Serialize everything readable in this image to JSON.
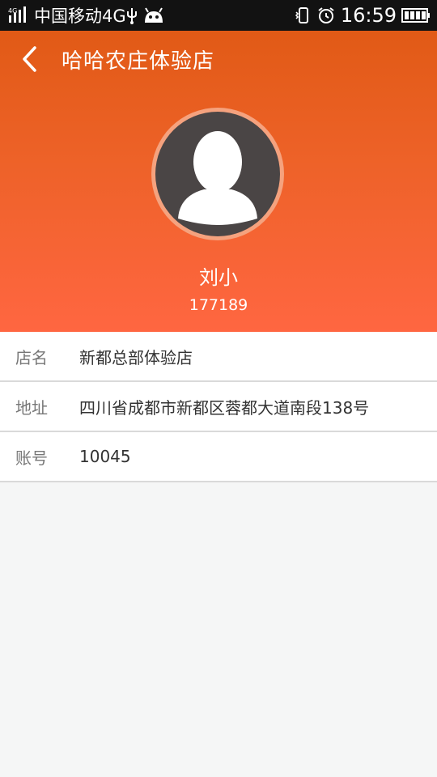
{
  "status_bar": {
    "network_type": "4G",
    "carrier": "中国移动4G",
    "time": "16:59",
    "icons": [
      "signal-icon",
      "usb-icon",
      "android-icon",
      "vibrate-icon",
      "alarm-icon",
      "battery-icon"
    ]
  },
  "nav": {
    "title": "哈哈农庄体验店",
    "back_icon": "chevron-left-icon"
  },
  "profile": {
    "name": "刘小",
    "id": "177189"
  },
  "info": {
    "rows": [
      {
        "label": "店名",
        "value": "新都总部体验店"
      },
      {
        "label": "地址",
        "value": "四川省成都市新都区蓉都大道南段138号"
      },
      {
        "label": "账号",
        "value": "10045"
      }
    ]
  },
  "colors": {
    "header_top": "#e15a16",
    "header_bottom": "#ff6641",
    "avatar_ring": "#f5a27e",
    "avatar_bg": "#4a4545",
    "page_bg": "#f5f6f6"
  }
}
